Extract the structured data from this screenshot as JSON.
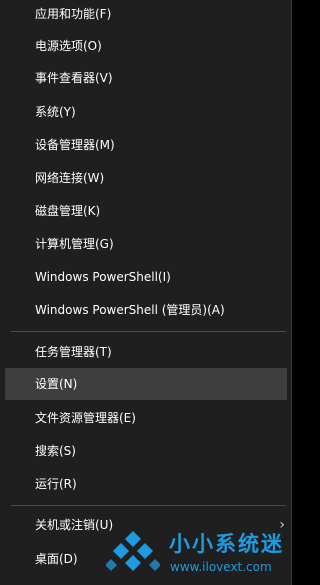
{
  "menu": {
    "items": [
      {
        "label": "应用和功能(F)"
      },
      {
        "label": "电源选项(O)"
      },
      {
        "label": "事件查看器(V)"
      },
      {
        "label": "系统(Y)"
      },
      {
        "label": "设备管理器(M)"
      },
      {
        "label": "网络连接(W)"
      },
      {
        "label": "磁盘管理(K)"
      },
      {
        "label": "计算机管理(G)"
      },
      {
        "label": "Windows PowerShell(I)"
      },
      {
        "label": "Windows PowerShell (管理员)(A)"
      },
      {
        "label": "任务管理器(T)"
      },
      {
        "label": "设置(N)",
        "highlighted": true
      },
      {
        "label": "文件资源管理器(E)"
      },
      {
        "label": "搜索(S)"
      },
      {
        "label": "运行(R)"
      },
      {
        "label": "关机或注销(U)",
        "submenu_icon": "chevron-right-icon"
      },
      {
        "label": "桌面(D)"
      }
    ],
    "colors": {
      "background": "#1f1f1f",
      "highlight": "#3e3e3e",
      "text": "#ffffff",
      "separator": "#4a4a4a"
    }
  },
  "watermark": {
    "title": "小小系统迷",
    "url": "www.ilovext.com",
    "color": "#1e9be0",
    "icon": "diamond-logo-icon"
  }
}
